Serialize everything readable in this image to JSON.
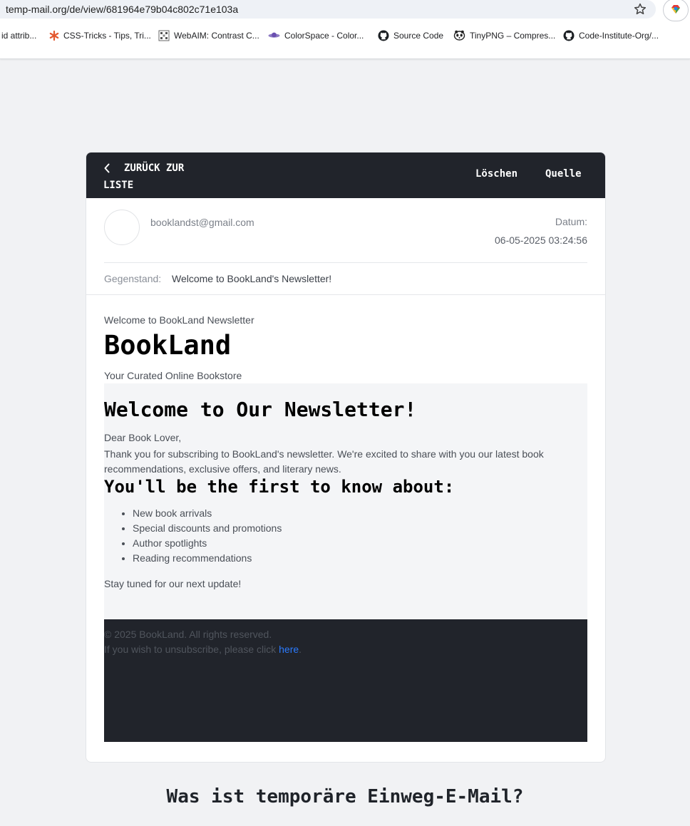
{
  "browser": {
    "url": "temp-mail.org/de/view/681964e79b04c802c71e103a",
    "bookmarks": [
      {
        "label": "id attrib...",
        "icon": "none"
      },
      {
        "label": "CSS-Tricks - Tips, Tri...",
        "icon": "css-tricks-icon"
      },
      {
        "label": "WebAIM: Contrast C...",
        "icon": "webaim-icon"
      },
      {
        "label": "ColorSpace - Color...",
        "icon": "colorspace-icon"
      },
      {
        "label": "Source Code",
        "icon": "github-icon"
      },
      {
        "label": "TinyPNG – Compres...",
        "icon": "tinypng-icon"
      },
      {
        "label": "Code-Institute-Org/...",
        "icon": "github-icon"
      }
    ]
  },
  "email": {
    "back_label": "ZURÜCK ZUR LISTE",
    "delete_label": "Löschen",
    "source_label": "Quelle",
    "sender": "booklandst@gmail.com",
    "date_label": "Datum:",
    "date_value": "06-05-2025 03:24:56",
    "subject_label": "Gegenstand:",
    "subject_value": "Welcome to BookLand's Newsletter!"
  },
  "newsletter": {
    "preheader": "Welcome to BookLand Newsletter",
    "brand": "BookLand",
    "tagline": "Your Curated Online Bookstore",
    "heading": "Welcome to Our Newsletter!",
    "greeting": "Dear Book Lover,",
    "paragraph": "Thank you for subscribing to BookLand's newsletter. We're excited to share with you our latest book recommendations, exclusive offers, and literary news.",
    "subheading": "You'll be the first to know about:",
    "items": [
      "New book arrivals",
      "Special discounts and promotions",
      "Author spotlights",
      "Reading recommendations"
    ],
    "closing": "Stay tuned for our next update!",
    "footer_copyright": "© 2025 BookLand. All rights reserved.",
    "footer_unsub_text": "If you wish to unsubscribe, please click ",
    "footer_unsub_link": "here",
    "footer_unsub_end": "."
  },
  "page": {
    "section_title": "Was ist temporäre Einweg-E-Mail?"
  },
  "colors": {
    "header_bg": "#21242b",
    "link": "#2b7bff",
    "page_bg": "#f1f2f4"
  }
}
